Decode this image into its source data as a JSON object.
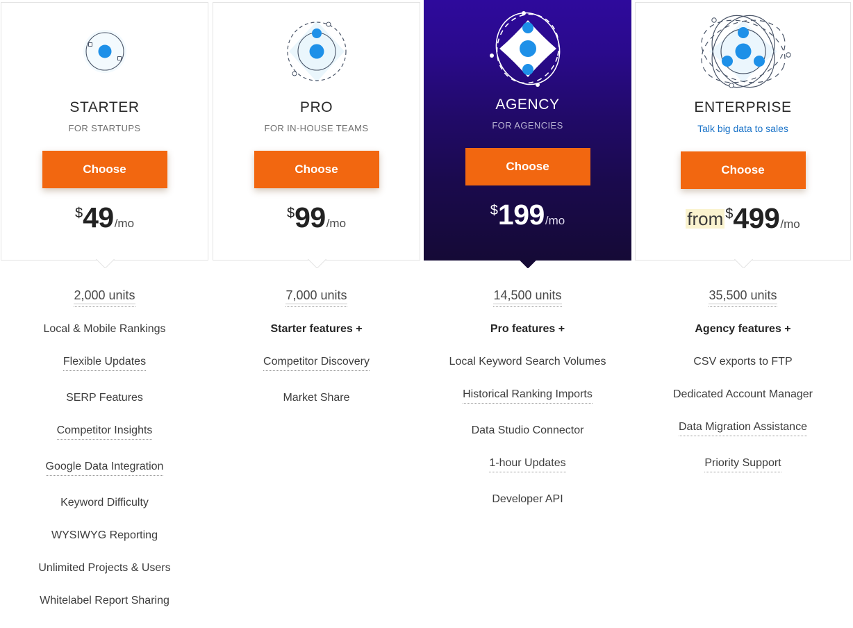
{
  "plans": [
    {
      "id": "starter",
      "name": "STARTER",
      "tagline": "FOR STARTUPS",
      "tagline_is_link": false,
      "button_label": "Choose",
      "price_prefix": "",
      "currency": "$",
      "amount": "49",
      "period": "/mo",
      "units": "2,000 units",
      "featured": false,
      "icon": "atom-icon-1-electron",
      "features": [
        {
          "label": "Local & Mobile Rankings",
          "tooltip": false,
          "bold": false
        },
        {
          "label": "Flexible Updates",
          "tooltip": true,
          "bold": false
        },
        {
          "label": "SERP Features",
          "tooltip": false,
          "bold": false
        },
        {
          "label": "Competitor Insights",
          "tooltip": true,
          "bold": false
        },
        {
          "label": "Google Data Integration",
          "tooltip": true,
          "bold": false
        },
        {
          "label": "Keyword Difficulty",
          "tooltip": false,
          "bold": false
        },
        {
          "label": "WYSIWYG Reporting",
          "tooltip": false,
          "bold": false
        },
        {
          "label": "Unlimited Projects & Users",
          "tooltip": false,
          "bold": false
        },
        {
          "label": "Whitelabel Report Sharing",
          "tooltip": false,
          "bold": false
        }
      ]
    },
    {
      "id": "pro",
      "name": "PRO",
      "tagline": "FOR IN-HOUSE TEAMS",
      "tagline_is_link": false,
      "button_label": "Choose",
      "price_prefix": "",
      "currency": "$",
      "amount": "99",
      "period": "/mo",
      "units": "7,000 units",
      "featured": false,
      "icon": "atom-icon-2-electrons",
      "features": [
        {
          "label": "Starter features +",
          "tooltip": false,
          "bold": true
        },
        {
          "label": "Competitor Discovery",
          "tooltip": true,
          "bold": false
        },
        {
          "label": "Market Share",
          "tooltip": false,
          "bold": false
        }
      ]
    },
    {
      "id": "agency",
      "name": "AGENCY",
      "tagline": "FOR AGENCIES",
      "tagline_is_link": false,
      "button_label": "Choose",
      "price_prefix": "",
      "currency": "$",
      "amount": "199",
      "period": "/mo",
      "units": "14,500 units",
      "featured": true,
      "icon": "atom-icon-3-electrons-dark",
      "features": [
        {
          "label": "Pro features +",
          "tooltip": false,
          "bold": true
        },
        {
          "label": "Local Keyword Search Volumes",
          "tooltip": false,
          "bold": false
        },
        {
          "label": "Historical Ranking Imports",
          "tooltip": true,
          "bold": false
        },
        {
          "label": "Data Studio Connector",
          "tooltip": false,
          "bold": false
        },
        {
          "label": "1-hour Updates",
          "tooltip": true,
          "bold": false
        },
        {
          "label": "Developer API",
          "tooltip": false,
          "bold": false
        }
      ]
    },
    {
      "id": "enterprise",
      "name": "ENTERPRISE",
      "tagline": "Talk big data to sales",
      "tagline_is_link": true,
      "button_label": "Choose",
      "price_prefix": "from",
      "currency": "$",
      "amount": "499",
      "period": "/mo",
      "units": "35,500 units",
      "featured": false,
      "icon": "atom-icon-4-electrons",
      "features": [
        {
          "label": "Agency features +",
          "tooltip": false,
          "bold": true
        },
        {
          "label": "CSV exports to FTP",
          "tooltip": false,
          "bold": false
        },
        {
          "label": "Dedicated Account Manager",
          "tooltip": false,
          "bold": false
        },
        {
          "label": "Data Migration Assistance",
          "tooltip": true,
          "bold": false
        },
        {
          "label": "Priority Support",
          "tooltip": true,
          "bold": false
        }
      ]
    }
  ],
  "colors": {
    "accent_button": "#f26710",
    "electron_blue": "#1e90e8",
    "featured_gradient_top": "#2e0a9c",
    "featured_gradient_bottom": "#150a36",
    "link_blue": "#1a73c8",
    "from_highlight": "#faf3cf",
    "card_border": "#e3e3e3"
  }
}
